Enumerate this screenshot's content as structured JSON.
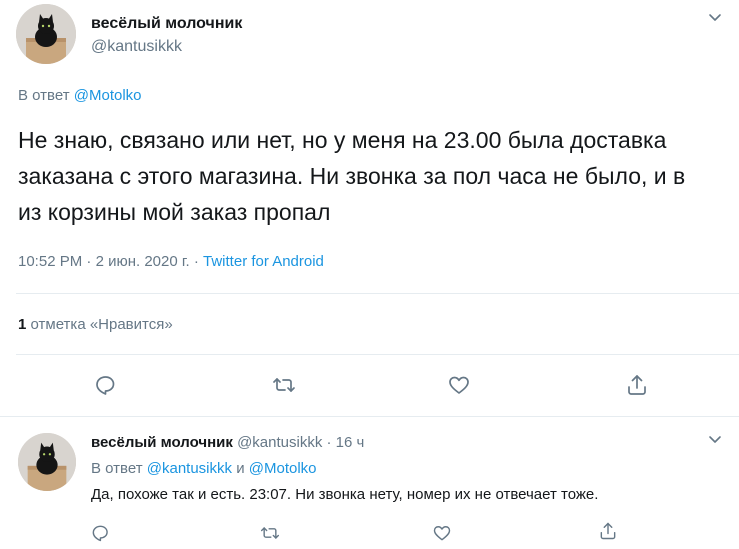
{
  "main_tweet": {
    "display_name": "весёлый молочник",
    "handle": "@kantusikkk",
    "reply_prefix": "В ответ",
    "reply_to": "@Motolko",
    "text": "Не знаю, связано или нет, но у меня на 23.00 была доставка заказана с этого магазина. Ни звонка за пол часа не было, и в из корзины мой заказ пропал",
    "time": "10:52 PM",
    "sep1": "·",
    "date": "2 июн. 2020 г.",
    "sep2": "·",
    "source": "Twitter for Android",
    "likes_count": "1",
    "likes_label": "отметка «Нравится»"
  },
  "reply_tweet": {
    "display_name": "весёлый молочник",
    "handle": "@kantusikkk",
    "sep": "·",
    "age": "16 ч",
    "reply_prefix": "В ответ",
    "reply_to_1": "@kantusikkk",
    "reply_and": "и",
    "reply_to_2": "@Motolko",
    "text": "Да, похоже так и есть. 23:07. Ни звонка нету, номер их не отвечает тоже."
  },
  "colors": {
    "link": "#1b95e0",
    "muted": "#657786",
    "text": "#14171a",
    "divider": "#e6ecf0"
  }
}
